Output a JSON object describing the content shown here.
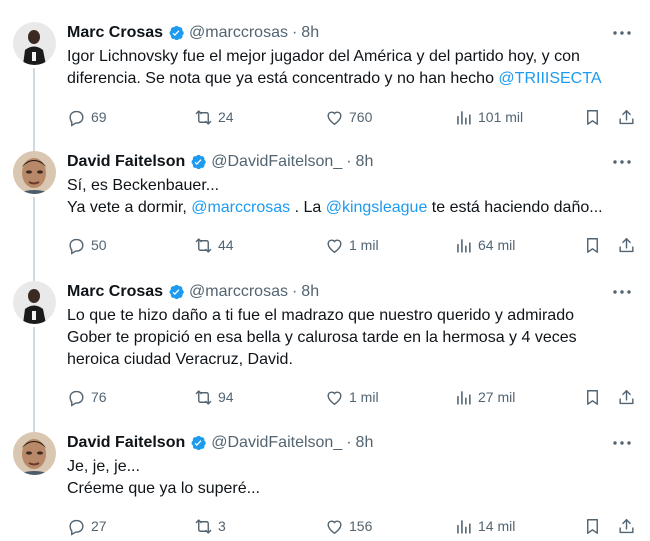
{
  "tweets": [
    {
      "name": "Marc Crosas",
      "handle": "@marccrosas",
      "time": "8h",
      "lines": [
        {
          "text": "Igor Lichnovsky fue el mejor jugador del América y del partido hoy, y con",
          "mention": "",
          "tail": ""
        },
        {
          "text": "diferencia. Se nota que ya está concentrado y no han hecho ",
          "mention": "@TRIIISECTA",
          "tail": ""
        }
      ],
      "replies": "69",
      "reposts": "24",
      "likes": "760",
      "views": "101 mil"
    },
    {
      "name": "David Faitelson",
      "handle": "@DavidFaitelson_",
      "time": "8h",
      "lines": [
        {
          "text": "Sí, es Beckenbauer...",
          "mention": "",
          "tail": ""
        },
        {
          "text": "Ya vete a dormir, ",
          "mention": "@marccrosas",
          "tail": " . La ",
          "mention2": "@kingsleague",
          "tail2": " te está haciendo daño..."
        }
      ],
      "replies": "50",
      "reposts": "44",
      "likes": "1 mil",
      "views": "64 mil"
    },
    {
      "name": "Marc Crosas",
      "handle": "@marccrosas",
      "time": "8h",
      "lines": [
        {
          "text": "Lo que te hizo daño a ti fue el madrazo que nuestro querido y admirado",
          "mention": "",
          "tail": ""
        },
        {
          "text": "Gober te propició en esa bella y calurosa tarde en la hermosa y 4 veces",
          "mention": "",
          "tail": ""
        },
        {
          "text": "heroica ciudad Veracruz, David.",
          "mention": "",
          "tail": ""
        }
      ],
      "replies": "76",
      "reposts": "94",
      "likes": "1 mil",
      "views": "27 mil"
    },
    {
      "name": "David Faitelson",
      "handle": "@DavidFaitelson_",
      "time": "8h",
      "lines": [
        {
          "text": "Je, je, je...",
          "mention": "",
          "tail": ""
        },
        {
          "text": "Créeme que ya lo superé...",
          "mention": "",
          "tail": ""
        }
      ],
      "replies": "27",
      "reposts": "3",
      "likes": "156",
      "views": "14 mil"
    }
  ],
  "dot": "·",
  "colors": {
    "accent": "#1d9bf0",
    "muted": "#536471",
    "text": "#0f1419",
    "thread_line": "#cfd9de"
  }
}
